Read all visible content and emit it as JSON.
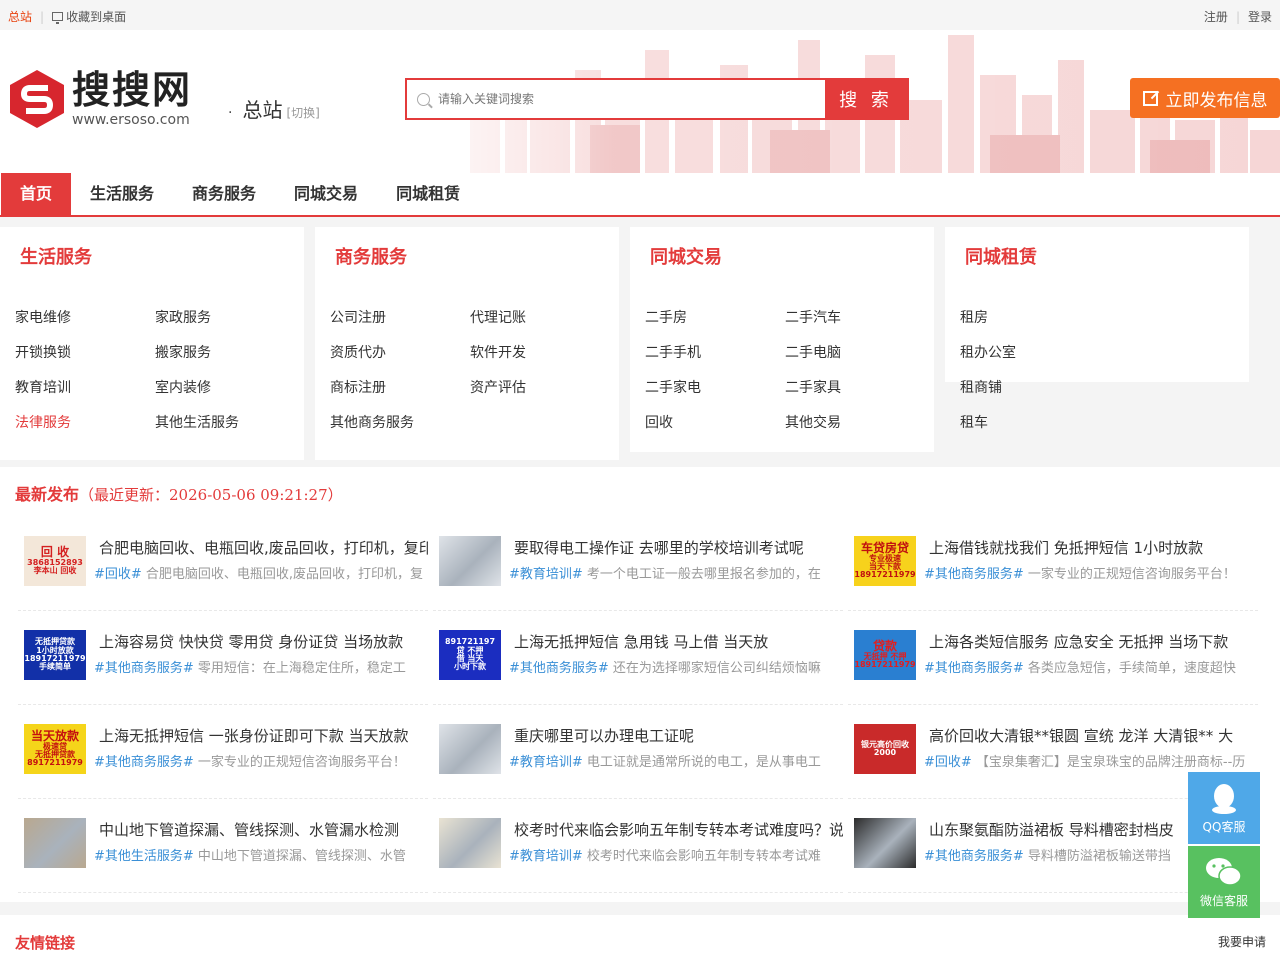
{
  "topbar": {
    "home": "总站",
    "favorite": "收藏到桌面",
    "register": "注册",
    "login": "登录"
  },
  "header": {
    "logo_title": "搜搜网",
    "logo_url": "www.ersoso.com",
    "city_dot": "·",
    "city": "总站",
    "switch": "[切换]",
    "search_placeholder": "请输入关键词搜索",
    "search_button": "搜 索",
    "publish": "立即发布信息"
  },
  "nav": [
    "首页",
    "生活服务",
    "商务服务",
    "同城交易",
    "同城租赁"
  ],
  "categories": [
    {
      "title": "生活服务",
      "items": [
        "家电维修",
        "家政服务",
        "开锁换锁",
        "搬家服务",
        "教育培训",
        "室内装修",
        "法律服务",
        "其他生活服务"
      ]
    },
    {
      "title": "商务服务",
      "items": [
        "公司注册",
        "代理记账",
        "资质代办",
        "软件开发",
        "商标注册",
        "资产评估",
        "其他商务服务"
      ]
    },
    {
      "title": "同城交易",
      "items": [
        "二手房",
        "二手汽车",
        "二手手机",
        "二手电脑",
        "二手家电",
        "二手家具",
        "回收",
        "其他交易"
      ]
    },
    {
      "title": "同城租赁",
      "items": [
        "租房",
        "租办公室",
        "租商铺",
        "租车"
      ]
    }
  ],
  "latest": {
    "title": "最新发布",
    "updated": "（最近更新：2026-05-06 09:21:27）",
    "posts": [
      {
        "title": "合肥电脑回收、电瓶回收,废品回收，打印机，复印",
        "tag": "#回收#",
        "desc": "合肥电脑回收、电瓶回收,废品回收，打印机，复"
      },
      {
        "title": "要取得电工操作证 去哪里的学校培训考试呢",
        "tag": "#教育培训#",
        "desc": "考一个电工证一般去哪里报名参加的，在"
      },
      {
        "title": "上海借钱就找我们 免抵押短信 1小时放款",
        "tag": "#其他商务服务#",
        "desc": "一家专业的正规短信咨询服务平台！"
      },
      {
        "title": "上海容易贷 快快贷 零用贷 身份证贷 当场放款",
        "tag": "#其他商务服务#",
        "desc": "零用短信：在上海稳定住所，稳定工"
      },
      {
        "title": "上海无抵押短信 急用钱 马上借 当天放",
        "tag": "#其他商务服务#",
        "desc": "还在为选择哪家短信公司纠结烦恼嘛"
      },
      {
        "title": "上海各类短信服务 应急安全 无抵押 当场下款",
        "tag": "#其他商务服务#",
        "desc": "各类应急短信，手续简单，速度超快"
      },
      {
        "title": "上海无抵押短信 一张身份证即可下款 当天放款",
        "tag": "#其他商务服务#",
        "desc": "一家专业的正规短信咨询服务平台！"
      },
      {
        "title": "重庆哪里可以办理电工证呢",
        "tag": "#教育培训#",
        "desc": "电工证就是通常所说的电工，是从事电工"
      },
      {
        "title": "高价回收大清银**银圆 宣统 龙洋 大清银** 大",
        "tag": "#回收#",
        "desc": "【宝泉集奢汇】是宝泉珠宝的品牌注册商标--历"
      },
      {
        "title": "中山地下管道探漏、管线探测、水管漏水检测",
        "tag": "#其他生活服务#",
        "desc": "中山地下管道探漏、管线探测、水管"
      },
      {
        "title": "校考时代来临会影响五年制专转本考试难度吗？说",
        "tag": "#教育培训#",
        "desc": "校考时代来临会影响五年制专转本考试难"
      },
      {
        "title": "山东聚氨酯防溢裙板 导料槽密封档皮",
        "tag": "#其他商务服务#",
        "desc": "导料槽防溢裙板输送带挡"
      }
    ],
    "thumbs": [
      {
        "lines": [
          "回 收",
          "3868152893",
          "李本山 回收"
        ]
      },
      {
        "lines": []
      },
      {
        "lines": [
          "车贷房贷",
          "专业极速",
          "当天下款",
          "18917211979"
        ]
      },
      {
        "lines": [
          "无抵押贷款",
          "1小时放款",
          "18917211979",
          "手续简单"
        ]
      },
      {
        "lines": [
          "891721197",
          "贷 不押",
          "借 当天",
          "小时下款"
        ]
      },
      {
        "lines": [
          "贷款",
          "无抵押 不押",
          "18917211979"
        ]
      },
      {
        "lines": [
          "当天放款",
          "极速贷",
          "无抵押贷款",
          "8917211979"
        ]
      },
      {
        "lines": []
      },
      {
        "lines": [
          "银元高价回收",
          "2000"
        ]
      },
      {
        "lines": []
      },
      {
        "lines": []
      },
      {
        "lines": []
      }
    ]
  },
  "friends": {
    "title": "友情链接",
    "apply": "我要申请"
  },
  "float": {
    "qq": "QQ客服",
    "wechat": "微信客服"
  },
  "colors": {
    "primary": "#e33b3b",
    "publish": "#f57022",
    "tag": "#3a8fd6",
    "qq": "#4fa8e8",
    "wechat": "#58c160"
  }
}
